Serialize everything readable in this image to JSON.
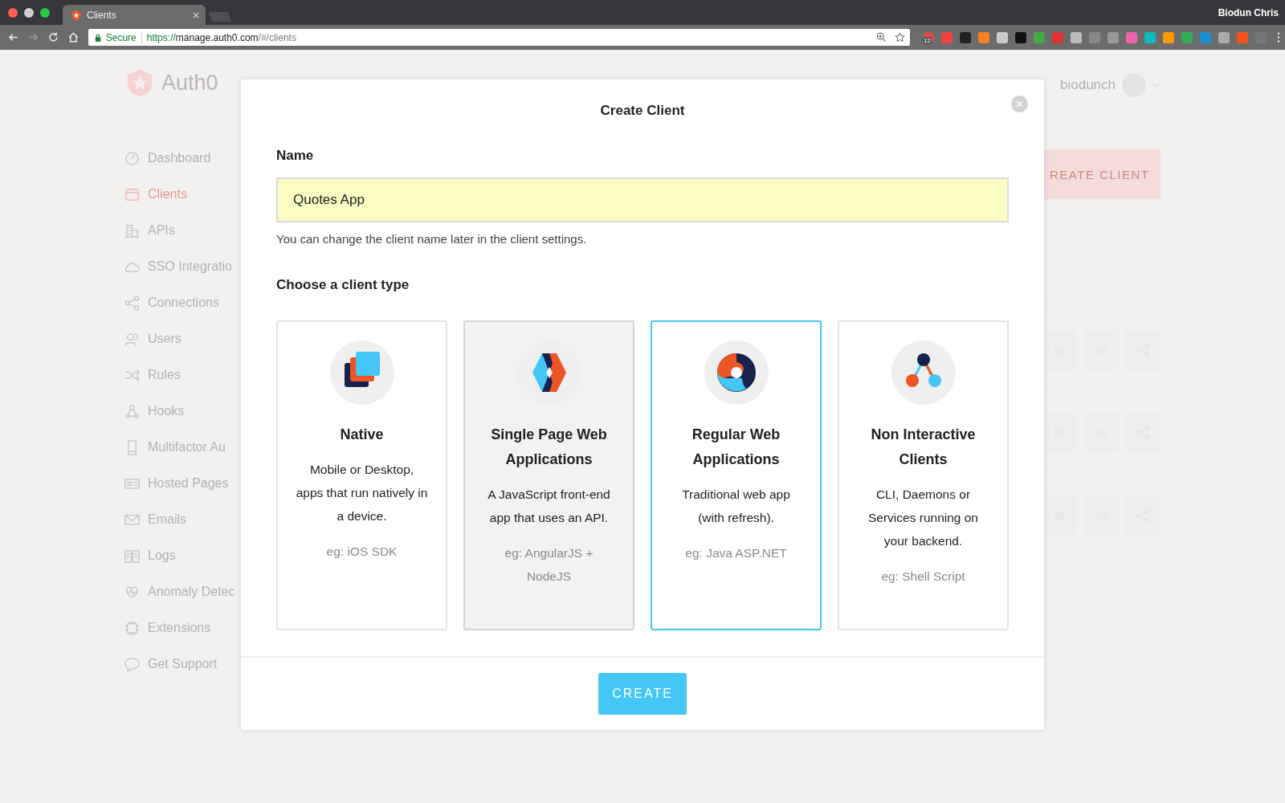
{
  "browser": {
    "tab": {
      "title": "Clients"
    },
    "url": {
      "secure_label": "Secure",
      "scheme": "https://",
      "host": "manage.auth0.com",
      "path": "/#/clients"
    },
    "profile_name": "Biodun Chris",
    "extension_badge": "12"
  },
  "background": {
    "logo": "Auth0",
    "sidebar_items": [
      {
        "label": "Dashboard",
        "selected": false
      },
      {
        "label": "Clients",
        "selected": true
      },
      {
        "label": "APIs",
        "selected": false
      },
      {
        "label": "SSO Integratio",
        "selected": false
      },
      {
        "label": "Connections",
        "selected": false
      },
      {
        "label": "Users",
        "selected": false
      },
      {
        "label": "Rules",
        "selected": false
      },
      {
        "label": "Hooks",
        "selected": false
      },
      {
        "label": "Multifactor Au",
        "selected": false
      },
      {
        "label": "Hosted Pages",
        "selected": false
      },
      {
        "label": "Emails",
        "selected": false
      },
      {
        "label": "Logs",
        "selected": false
      },
      {
        "label": "Anomaly Detec",
        "selected": false
      },
      {
        "label": "Extensions",
        "selected": false
      },
      {
        "label": "Get Support",
        "selected": false
      }
    ],
    "user": "biodunch",
    "create_button": "REATE CLIENT"
  },
  "modal": {
    "title": "Create Client",
    "name_label": "Name",
    "name_value": "Quotes App",
    "name_hint": "You can change the client name later in the client settings.",
    "type_heading": "Choose a client type",
    "client_types": [
      {
        "kind": "native",
        "title": "Native",
        "description": "Mobile or Desktop, apps that run natively in a device.",
        "example": "eg: iOS SDK",
        "selected": false,
        "hovered": false
      },
      {
        "kind": "spa",
        "title": "Single Page Web Applications",
        "description": "A JavaScript front-end app that uses an API.",
        "example": "eg: AngularJS + NodeJS",
        "selected": false,
        "hovered": true
      },
      {
        "kind": "regular",
        "title": "Regular Web Applications",
        "description": "Traditional web app (with refresh).",
        "example": "eg: Java ASP.NET",
        "selected": true,
        "hovered": false
      },
      {
        "kind": "noninteractive",
        "title": "Non Interactive Clients",
        "description": "CLI, Daemons or Services running on your backend.",
        "example": "eg: Shell Script",
        "selected": false,
        "hovered": false
      }
    ],
    "create_button": "CREATE"
  }
}
